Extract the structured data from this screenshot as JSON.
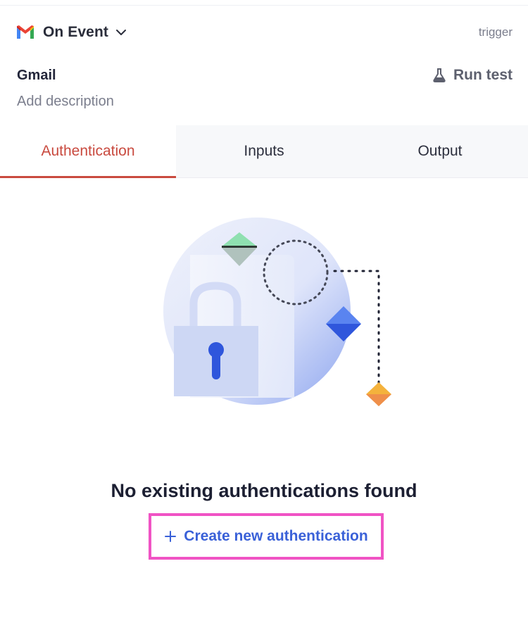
{
  "header": {
    "event_label": "On Event",
    "trigger_label": "trigger"
  },
  "step": {
    "title": "Gmail",
    "run_test_label": "Run test",
    "description_placeholder": "Add description"
  },
  "tabs": [
    {
      "label": "Authentication",
      "active": true
    },
    {
      "label": "Inputs",
      "active": false
    },
    {
      "label": "Output",
      "active": false
    }
  ],
  "empty_state": {
    "title": "No existing authentications found",
    "create_label": "Create new authentication"
  },
  "colors": {
    "active_tab": "#c94a3f",
    "link": "#3a61d8",
    "highlight": "#f053c4"
  },
  "icons": [
    "gmail-icon",
    "chevron-down-icon",
    "flask-icon",
    "lock-illustration",
    "plus-icon"
  ]
}
